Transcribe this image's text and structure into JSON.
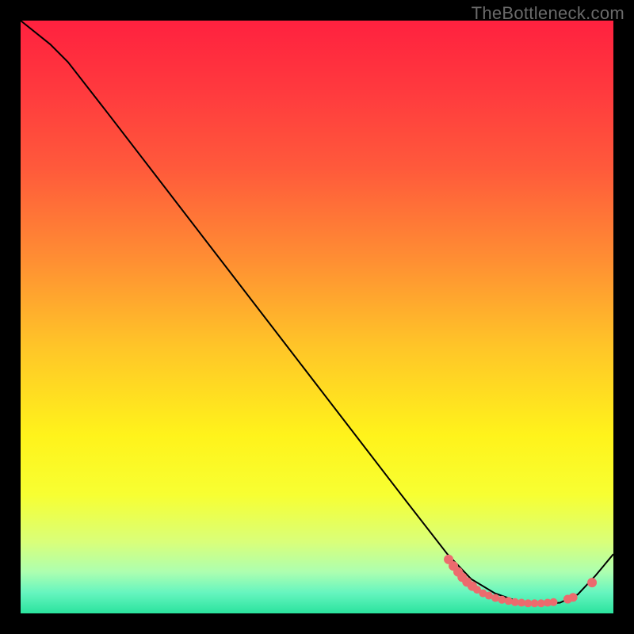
{
  "watermark": "TheBottleneck.com",
  "chart_data": {
    "type": "line",
    "title": "",
    "xlabel": "",
    "ylabel": "",
    "xlim": [
      0,
      100
    ],
    "ylim": [
      0,
      100
    ],
    "grid": false,
    "legend": false,
    "background_gradient": {
      "stops": [
        {
          "offset": 0.0,
          "color": "#ff213f"
        },
        {
          "offset": 0.12,
          "color": "#ff3a3e"
        },
        {
          "offset": 0.25,
          "color": "#ff5a3b"
        },
        {
          "offset": 0.4,
          "color": "#ff8d33"
        },
        {
          "offset": 0.55,
          "color": "#ffc528"
        },
        {
          "offset": 0.7,
          "color": "#fff31b"
        },
        {
          "offset": 0.8,
          "color": "#f7ff32"
        },
        {
          "offset": 0.88,
          "color": "#d9ff7a"
        },
        {
          "offset": 0.93,
          "color": "#adffb0"
        },
        {
          "offset": 0.965,
          "color": "#66f5bf"
        },
        {
          "offset": 1.0,
          "color": "#2be39e"
        }
      ]
    },
    "series": [
      {
        "name": "curve",
        "type": "line",
        "color": "#000000",
        "x": [
          0,
          5,
          8,
          15,
          25,
          35,
          45,
          55,
          65,
          72,
          76,
          80,
          84,
          88,
          91,
          94,
          97,
          100
        ],
        "y": [
          100,
          96,
          93,
          84,
          71,
          58,
          45,
          32,
          19,
          10,
          5.8,
          3.4,
          2.0,
          1.6,
          1.8,
          3.2,
          6.4,
          10
        ]
      },
      {
        "name": "markers",
        "type": "scatter",
        "color": "#ec6b6e",
        "x": [
          72.2,
          73.0,
          73.8,
          74.5,
          75.3,
          76.2,
          77.0,
          78.0,
          79.0,
          80.1,
          81.2,
          82.3,
          83.4,
          84.5,
          85.6,
          86.7,
          87.8,
          88.9,
          89.9,
          92.3,
          93.2,
          96.4
        ],
        "y": [
          9.1,
          8.0,
          7.0,
          6.1,
          5.3,
          4.6,
          4.0,
          3.4,
          3.0,
          2.6,
          2.3,
          2.1,
          1.9,
          1.8,
          1.7,
          1.7,
          1.7,
          1.8,
          1.9,
          2.4,
          2.7,
          5.2
        ],
        "r": [
          6,
          6,
          6,
          6,
          6,
          6,
          5,
          5,
          5,
          5,
          5,
          5,
          5,
          5,
          5,
          5,
          5,
          5,
          5,
          5.5,
          5.5,
          6
        ]
      }
    ]
  }
}
